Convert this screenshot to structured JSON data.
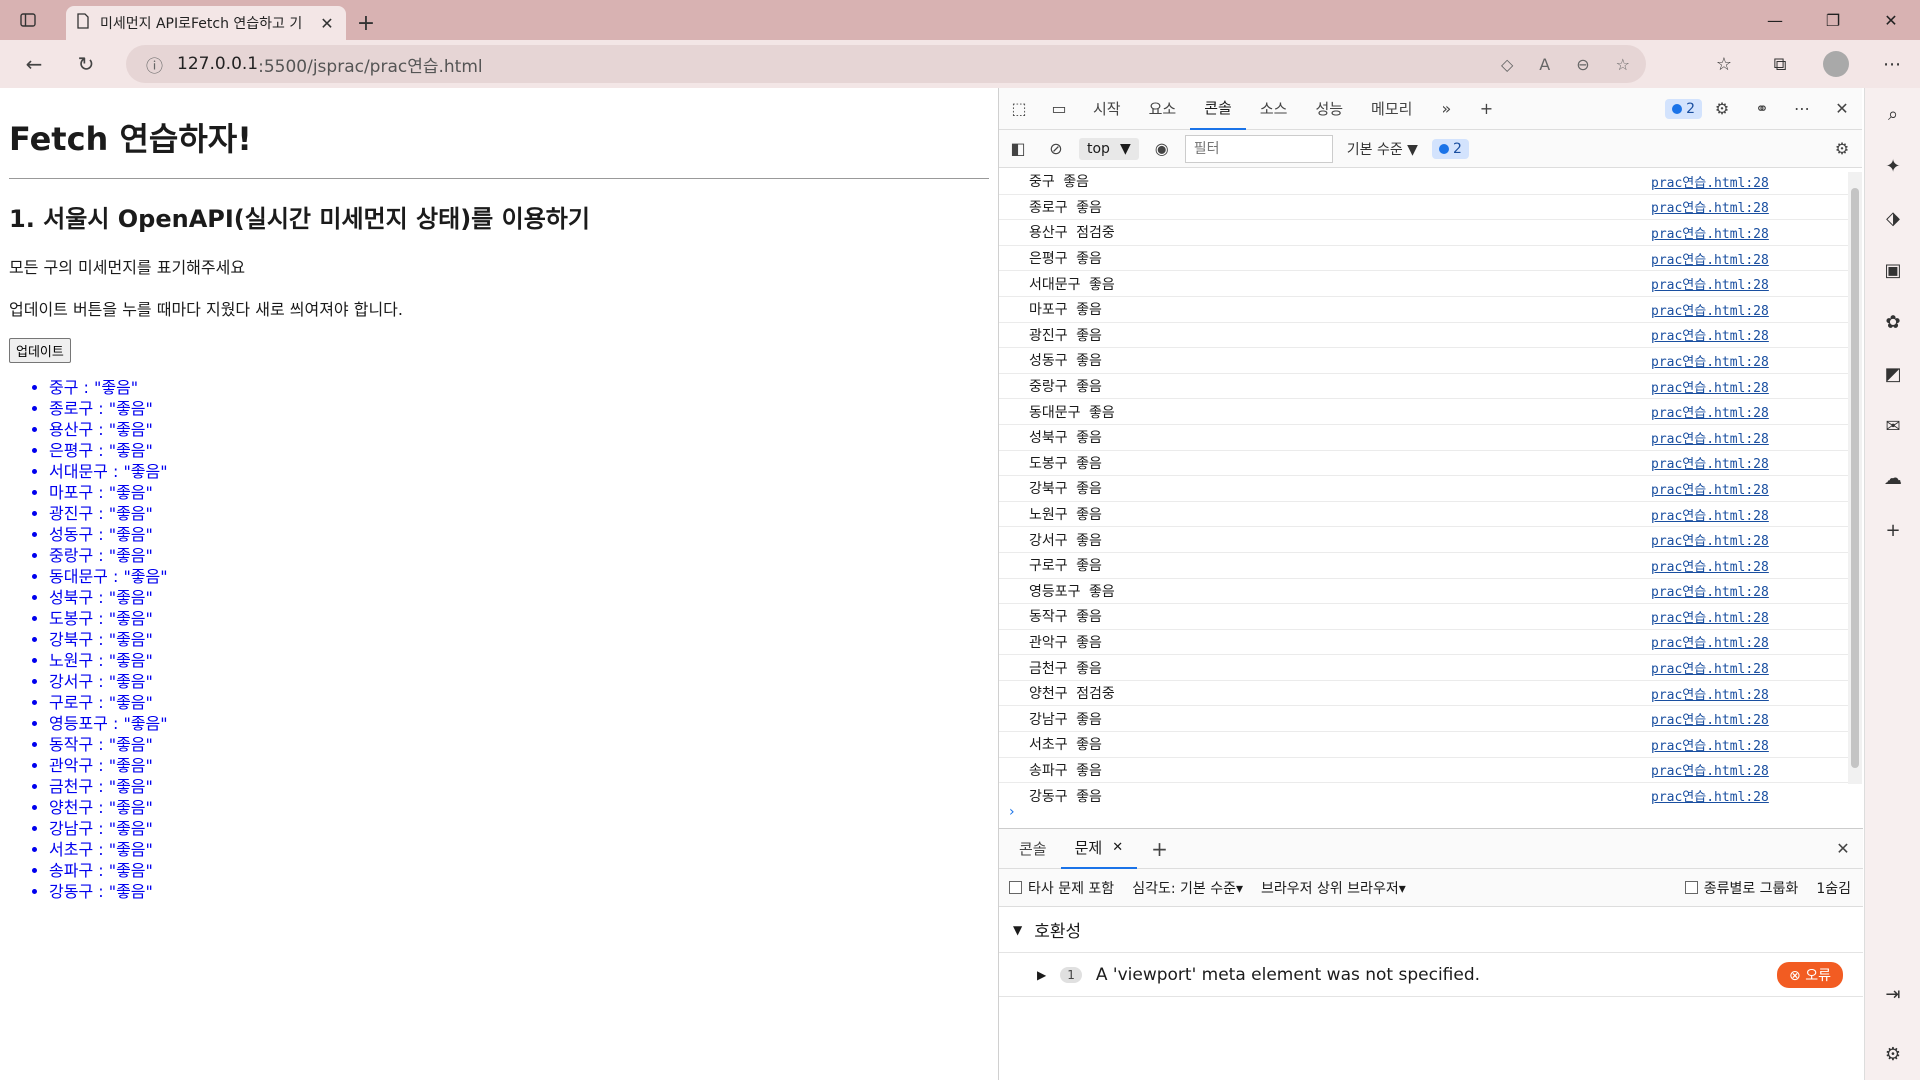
{
  "browser": {
    "tab_title": "미세먼지 API로Fetch 연습하고 기",
    "url_host": "127.0.0.1",
    "url_path": ":5500/jsprac/prac연습.html"
  },
  "page": {
    "h1": "Fetch 연습하자!",
    "h2": "1. 서울시 OpenAPI(실시간 미세먼지 상태)를 이용하기",
    "p1": "모든 구의 미세먼지를 표기해주세요",
    "p2": "업데이트 버튼을 누를 때마다 지웠다 새로 씌여져야 합니다.",
    "update_button": "업데이트",
    "items": [
      "중구 : \"좋음\"",
      "종로구 : \"좋음\"",
      "용산구 : \"좋음\"",
      "은평구 : \"좋음\"",
      "서대문구 : \"좋음\"",
      "마포구 : \"좋음\"",
      "광진구 : \"좋음\"",
      "성동구 : \"좋음\"",
      "중랑구 : \"좋음\"",
      "동대문구 : \"좋음\"",
      "성북구 : \"좋음\"",
      "도봉구 : \"좋음\"",
      "강북구 : \"좋음\"",
      "노원구 : \"좋음\"",
      "강서구 : \"좋음\"",
      "구로구 : \"좋음\"",
      "영등포구 : \"좋음\"",
      "동작구 : \"좋음\"",
      "관악구 : \"좋음\"",
      "금천구 : \"좋음\"",
      "양천구 : \"좋음\"",
      "강남구 : \"좋음\"",
      "서초구 : \"좋음\"",
      "송파구 : \"좋음\"",
      "강동구 : \"좋음\""
    ]
  },
  "devtools": {
    "tabs": [
      "시작",
      "요소",
      "콘솔",
      "소스",
      "성능",
      "메모리"
    ],
    "active_tab": "콘솔",
    "message_count": "2",
    "context": "top",
    "filter_placeholder": "필터",
    "level": "기본 수준",
    "console_source": "prac연습.html:28",
    "console_rows": [
      "중구 좋음",
      "종로구 좋음",
      "용산구 점검중",
      "은평구 좋음",
      "서대문구 좋음",
      "마포구 좋음",
      "광진구 좋음",
      "성동구 좋음",
      "중랑구 좋음",
      "동대문구 좋음",
      "성북구 좋음",
      "도봉구 좋음",
      "강북구 좋음",
      "노원구 좋음",
      "강서구 좋음",
      "구로구 좋음",
      "영등포구 좋음",
      "동작구 좋음",
      "관악구 좋음",
      "금천구 좋음",
      "양천구 점검중",
      "강남구 좋음",
      "서초구 좋음",
      "송파구 좋음",
      "강동구 좋음"
    ],
    "drawer": {
      "tab_console": "콘솔",
      "tab_issues": "문제",
      "third_party": "타사 문제 포함",
      "severity": "심각도: 기본 수준",
      "browser_filter": "브라우저 상위 브라우저",
      "group_by_kind": "종류별로 그룹화",
      "hidden_count": "1숨김",
      "section": "호환성",
      "issue_count": "1",
      "issue_text": "A 'viewport' meta element was not specified.",
      "error_badge": "오류"
    }
  }
}
